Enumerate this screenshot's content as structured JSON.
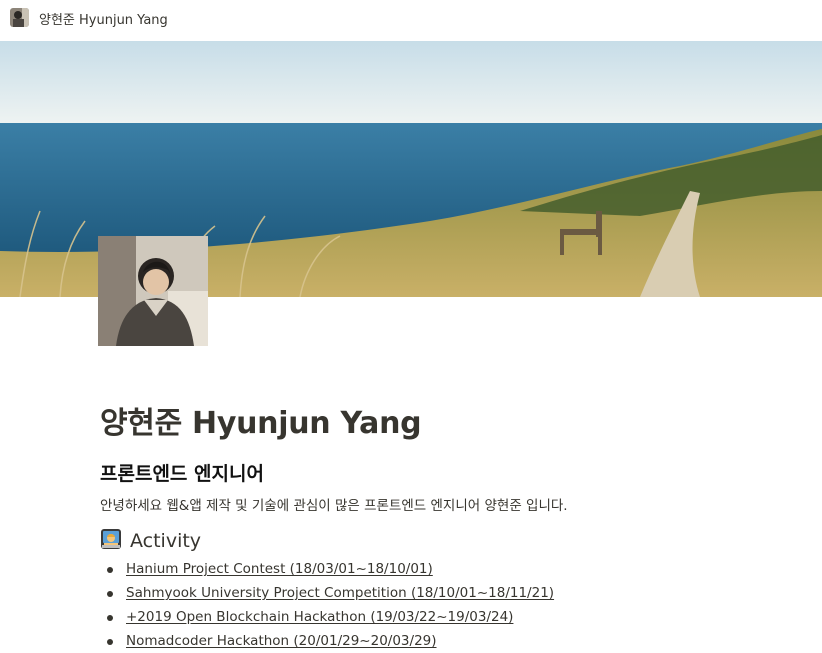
{
  "topbar": {
    "title": "양현준   Hyunjun Yang",
    "avatar_icon": "profile-photo"
  },
  "cover": {
    "image": "coastal-meadow-with-bench-and-path",
    "sky_color": "#dfe9ec",
    "sea_color": "#2f6f95",
    "grass_color": "#b9a35a"
  },
  "page": {
    "title": "양현준 Hyunjun Yang",
    "subtitle": "프론트엔드 엔지니어",
    "intro": "안녕하세요 웹&앱 제작 및 기술에 관심이 많은 프론트엔드 엔지니어 양현준 입니다."
  },
  "activity": {
    "icon": "technologist-emoji-icon",
    "heading": "Activity",
    "items": [
      {
        "label": "Hanium Project Contest (18/03/01~18/10/01)"
      },
      {
        "label": "Sahmyook University Project Competition (18/10/01~18/11/21)"
      },
      {
        "label": "+2019 Open Blockchain Hackathon (19/03/22~19/03/24)"
      },
      {
        "label": "Nomadcoder Hackathon (20/01/29~20/03/29)"
      }
    ]
  }
}
